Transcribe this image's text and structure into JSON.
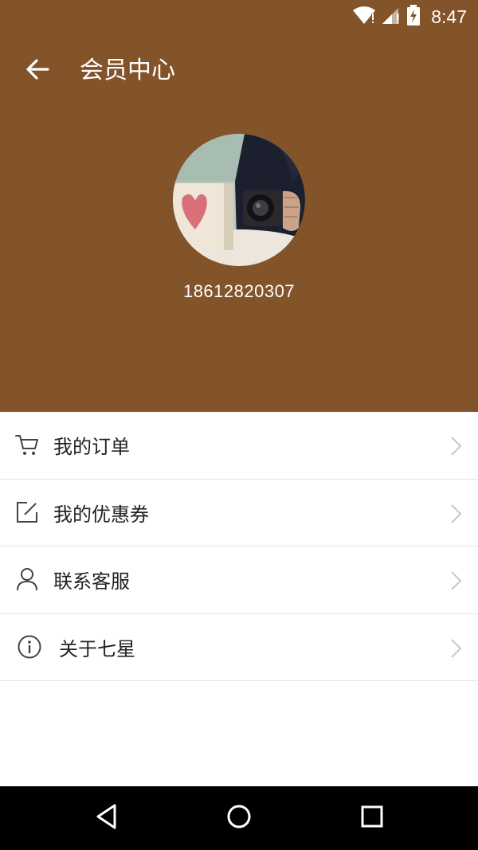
{
  "status_bar": {
    "time": "8:47",
    "icons": [
      "wifi-icon",
      "signal-icon",
      "battery-charging-icon"
    ]
  },
  "toolbar": {
    "title": "会员中心",
    "back_icon": "arrow-left-icon"
  },
  "profile": {
    "phone": "18612820307",
    "avatar_icon": "avatar-photo"
  },
  "menu": {
    "items": [
      {
        "label": "我的订单",
        "icon": "cart-icon"
      },
      {
        "label": "我的优惠券",
        "icon": "edit-icon"
      },
      {
        "label": "联系客服",
        "icon": "person-icon"
      },
      {
        "label": "关于七星",
        "icon": "info-icon"
      }
    ]
  },
  "nav_bar": {
    "icons": [
      "back-triangle-icon",
      "home-circle-icon",
      "recents-square-icon"
    ]
  },
  "colors": {
    "header_bg": "#83532a",
    "divider": "#e4e4e4",
    "chevron": "#c8c8c8"
  }
}
